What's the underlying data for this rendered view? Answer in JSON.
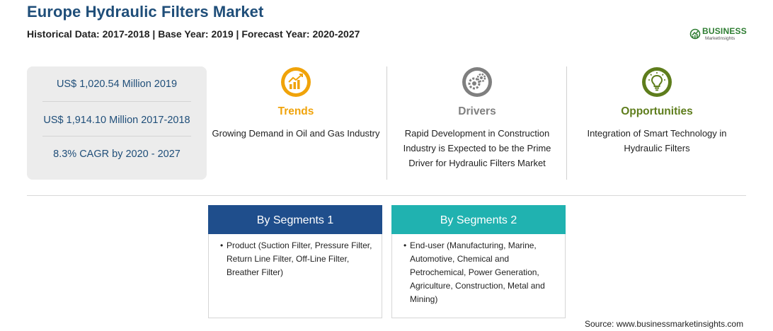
{
  "header": {
    "title": "Europe Hydraulic Filters Market",
    "subtitle": "Historical Data: 2017-2018 | Base Year: 2019 | Forecast Year: 2020-2027"
  },
  "logo": {
    "name": "BUSINESS",
    "tagline": "MarketInsights",
    "color": "#2e7d32"
  },
  "stats": [
    "US$ 1,020.54 Million 2019",
    "US$ 1,914.10 Million 2017-2018",
    "8.3% CAGR by 2020 - 2027"
  ],
  "columns": [
    {
      "heading": "Trends",
      "icon": "trend-chart-icon",
      "color": "#f0a30a",
      "description": "Growing Demand in Oil and Gas Industry"
    },
    {
      "heading": "Drivers",
      "icon": "gears-icon",
      "color": "#7f7f7f",
      "description": "Rapid Development in Construction Industry is Expected to be the Prime Driver for Hydraulic Filters Market"
    },
    {
      "heading": "Opportunities",
      "icon": "lightbulb-icon",
      "color": "#5e7d1c",
      "description": "Integration of Smart Technology in Hydraulic Filters"
    }
  ],
  "segments": [
    {
      "title": "By Segments 1",
      "color": "#1f4e8c",
      "items": [
        "Product (Suction Filter, Pressure Filter, Return Line Filter, Off-Line Filter, Breather Filter)"
      ]
    },
    {
      "title": "By Segments 2",
      "color": "#20b2b0",
      "items": [
        "End-user (Manufacturing, Marine, Automotive, Chemical and Petrochemical, Power Generation, Agriculture, Construction, Metal and Mining)"
      ]
    }
  ],
  "source": "Source: www.businessmarketinsights.com"
}
